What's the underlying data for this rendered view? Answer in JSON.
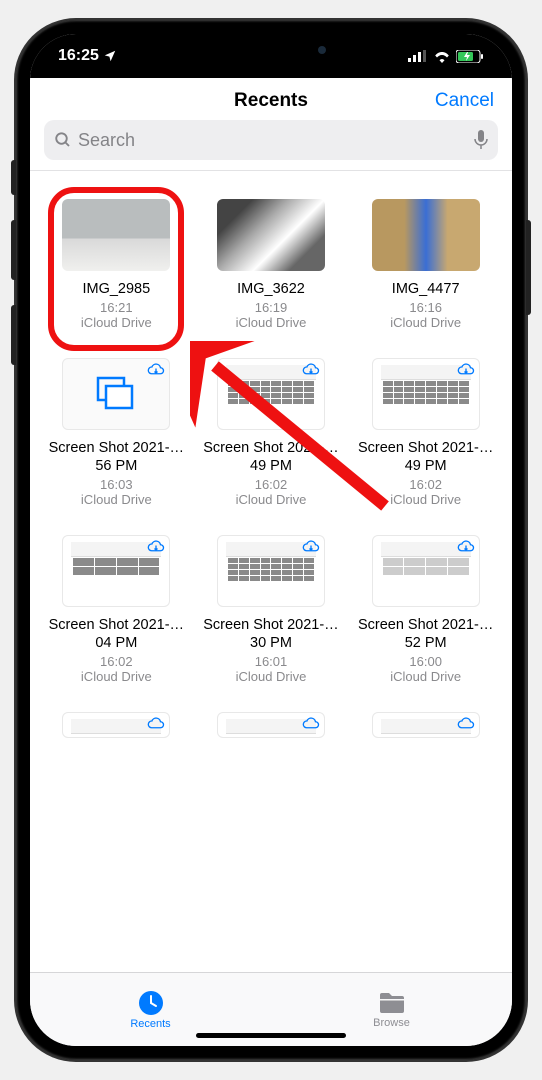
{
  "status": {
    "time": "16:25",
    "location_icon": "location-arrow-icon"
  },
  "nav": {
    "title": "Recents",
    "cancel": "Cancel"
  },
  "search": {
    "placeholder": "Search"
  },
  "files": [
    {
      "name": "IMG_2985",
      "time": "16:21",
      "location": "iCloud Drive",
      "kind": "photo1",
      "cloud": false
    },
    {
      "name": "IMG_3622",
      "time": "16:19",
      "location": "iCloud Drive",
      "kind": "photo2",
      "cloud": false
    },
    {
      "name": "IMG_4477",
      "time": "16:16",
      "location": "iCloud Drive",
      "kind": "photo3",
      "cloud": false
    },
    {
      "name": "Screen Shot 2021-…56 PM",
      "time": "16:03",
      "location": "iCloud Drive",
      "kind": "stack",
      "cloud": true
    },
    {
      "name": "Screen Shot 2021-…49 PM",
      "time": "16:02",
      "location": "iCloud Drive",
      "kind": "screenshot",
      "cloud": true
    },
    {
      "name": "Screen Shot 2021-…49 PM",
      "time": "16:02",
      "location": "iCloud Drive",
      "kind": "screenshot",
      "cloud": true
    },
    {
      "name": "Screen Shot 2021-…04 PM",
      "time": "16:02",
      "location": "iCloud Drive",
      "kind": "screenshot-sparse",
      "cloud": true
    },
    {
      "name": "Screen Shot 2021-…30 PM",
      "time": "16:01",
      "location": "iCloud Drive",
      "kind": "screenshot",
      "cloud": true
    },
    {
      "name": "Screen Shot 2021-…52 PM",
      "time": "16:00",
      "location": "iCloud Drive",
      "kind": "screenshot-sparse",
      "cloud": true
    }
  ],
  "tabs": {
    "recents": "Recents",
    "browse": "Browse"
  }
}
